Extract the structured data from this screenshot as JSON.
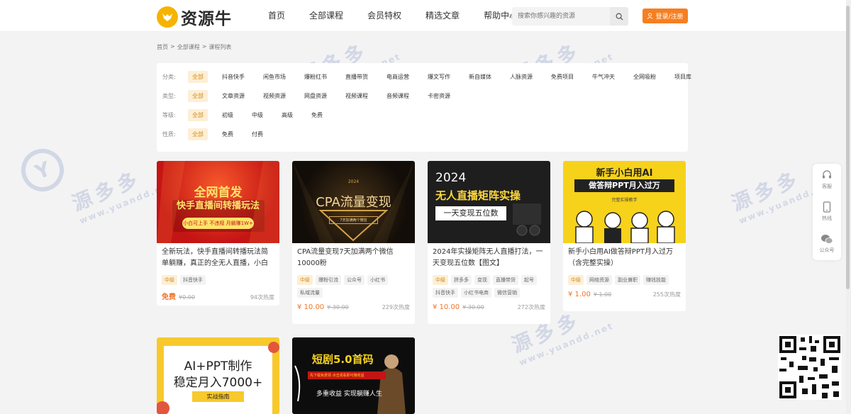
{
  "header": {
    "logo_text": "资源牛",
    "nav": [
      "首页",
      "全部课程",
      "会员特权",
      "精选文章",
      "帮助中心"
    ],
    "search_placeholder": "搜索你感兴趣的资源",
    "login_label": "登录/注册"
  },
  "breadcrumb": [
    "首页",
    ">",
    "全部课程",
    ">",
    "课程列表"
  ],
  "filters": {
    "category": {
      "label": "分类:",
      "options": [
        "全部",
        "抖音快手",
        "闲鱼市场",
        "爆粉红书",
        "直播带货",
        "电商运营",
        "爆文写作",
        "新自媒体",
        "人脉资源",
        "免费项目",
        "牛气冲天",
        "全网吸粉",
        "项目库"
      ]
    },
    "type": {
      "label": "类型:",
      "options": [
        "全部",
        "文章资源",
        "视频资源",
        "网盘资源",
        "视频课程",
        "音频课程",
        "卡密资源"
      ]
    },
    "level": {
      "label": "等级:",
      "options": [
        "全部",
        "初级",
        "中级",
        "高级",
        "免费"
      ]
    },
    "nature": {
      "label": "性质:",
      "options": [
        "全部",
        "免费",
        "付费"
      ]
    }
  },
  "cards": [
    {
      "title": "全新玩法，快手直播间转播玩法简单躺赚，真正的全无人直播，小白",
      "thumb_text": [
        "全网首发",
        "快手直播间转播玩法",
        "小白可上手 不违规 月躺赚1W+"
      ],
      "level": "中级",
      "tags": [
        "抖音快手"
      ],
      "price": "免费",
      "old_price": "¥0.00",
      "heat": "94次热度",
      "colors": {
        "thumb": "#d7261f"
      }
    },
    {
      "title": "CPA流量变现7天加满两个微信10000粉",
      "thumb_text": [
        "2024",
        "CPA流量变现",
        "7天加满两个微信"
      ],
      "level": "中级",
      "tags": [
        "爆粉引流",
        "公众号",
        "小红书",
        "私域流量"
      ],
      "price": "¥ 10.00",
      "old_price": "¥ 30.00",
      "heat": "229次热度",
      "colors": {
        "thumb": "#1a1510"
      }
    },
    {
      "title": "2024年实操矩阵无人直播打法，一天变现五位数【图文】",
      "thumb_text": [
        "2024",
        "无人直播矩阵实操",
        "一天变现五位数"
      ],
      "level": "中级",
      "tags": [
        "拼多多",
        "变现",
        "直播带货",
        "起号",
        "抖音快手",
        "小红书电商",
        "微信营销"
      ],
      "price": "¥ 10.00",
      "old_price": "¥ 30.00",
      "heat": "272次热度",
      "colors": {
        "thumb": "#1c1c1c"
      }
    },
    {
      "title": "新手小白用AI做答辩PPT月入过万（含完整实操）",
      "thumb_text": [
        "新手小白用AI",
        "做答辩PPT月入过万",
        "完整实操教学"
      ],
      "level": "中级",
      "tags": [
        "网络资源",
        "副业兼职",
        "赚钱技能"
      ],
      "price": "¥ 1.00",
      "old_price": "¥ 1.00",
      "heat": "255次热度",
      "colors": {
        "thumb": "#f7d21a"
      }
    },
    {
      "title": "",
      "thumb_text": [
        "AI+PPT制作",
        "稳定月入7000+",
        "实战指南"
      ],
      "level": "",
      "tags": [],
      "price": "",
      "old_price": "",
      "heat": "",
      "colors": {
        "thumb": "#f8c92c"
      }
    },
    {
      "title": "",
      "thumb_text": [
        "短剧5.0首码",
        "先下载免费领 点击观看即可赚收益",
        "多重收益 实现躺赚人生"
      ],
      "level": "",
      "tags": [],
      "price": "",
      "old_price": "",
      "heat": "",
      "colors": {
        "thumb": "#0d0d0d"
      }
    }
  ],
  "side_bar": [
    "客服",
    "热线",
    "公众号"
  ],
  "colors": {
    "accent": "#f57f21",
    "chip_active_bg": "#fcefd6",
    "chip_active_text": "#d68a16"
  }
}
